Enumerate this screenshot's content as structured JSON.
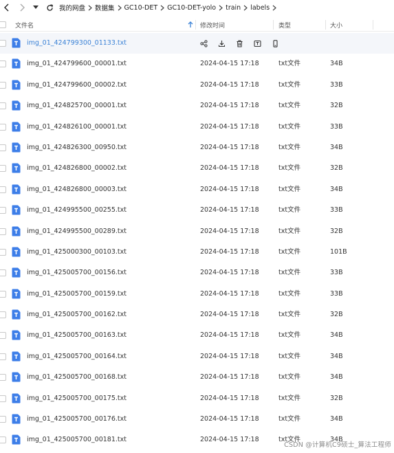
{
  "nav": {
    "breadcrumbs": [
      "我的网盘",
      "数据集",
      "GC10-DET",
      "GC10-DET-yolo",
      "train",
      "labels"
    ]
  },
  "header": {
    "name_label": "文件名",
    "modified_label": "修改时间",
    "type_label": "类型",
    "size_label": "大小"
  },
  "colors": {
    "file_icon": "#3d7ee8",
    "link": "#3b82d6",
    "hover_row": "#f4f6fa"
  },
  "files": [
    {
      "name": "img_01_424799300_01133.txt",
      "date": "",
      "type": "",
      "size": ""
    },
    {
      "name": "img_01_424799600_00001.txt",
      "date": "2024-04-15 17:18",
      "type": "txt文件",
      "size": "34B"
    },
    {
      "name": "img_01_424799600_00002.txt",
      "date": "2024-04-15 17:18",
      "type": "txt文件",
      "size": "33B"
    },
    {
      "name": "img_01_424825700_00001.txt",
      "date": "2024-04-15 17:18",
      "type": "txt文件",
      "size": "32B"
    },
    {
      "name": "img_01_424826100_00001.txt",
      "date": "2024-04-15 17:18",
      "type": "txt文件",
      "size": "33B"
    },
    {
      "name": "img_01_424826300_00950.txt",
      "date": "2024-04-15 17:18",
      "type": "txt文件",
      "size": "34B"
    },
    {
      "name": "img_01_424826800_00002.txt",
      "date": "2024-04-15 17:18",
      "type": "txt文件",
      "size": "32B"
    },
    {
      "name": "img_01_424826800_00003.txt",
      "date": "2024-04-15 17:18",
      "type": "txt文件",
      "size": "34B"
    },
    {
      "name": "img_01_424995500_00255.txt",
      "date": "2024-04-15 17:18",
      "type": "txt文件",
      "size": "33B"
    },
    {
      "name": "img_01_424995500_00289.txt",
      "date": "2024-04-15 17:18",
      "type": "txt文件",
      "size": "32B"
    },
    {
      "name": "img_01_425000300_00103.txt",
      "date": "2024-04-15 17:18",
      "type": "txt文件",
      "size": "101B"
    },
    {
      "name": "img_01_425005700_00156.txt",
      "date": "2024-04-15 17:18",
      "type": "txt文件",
      "size": "33B"
    },
    {
      "name": "img_01_425005700_00159.txt",
      "date": "2024-04-15 17:18",
      "type": "txt文件",
      "size": "33B"
    },
    {
      "name": "img_01_425005700_00162.txt",
      "date": "2024-04-15 17:18",
      "type": "txt文件",
      "size": "32B"
    },
    {
      "name": "img_01_425005700_00163.txt",
      "date": "2024-04-15 17:18",
      "type": "txt文件",
      "size": "34B"
    },
    {
      "name": "img_01_425005700_00164.txt",
      "date": "2024-04-15 17:18",
      "type": "txt文件",
      "size": "34B"
    },
    {
      "name": "img_01_425005700_00168.txt",
      "date": "2024-04-15 17:18",
      "type": "txt文件",
      "size": "34B"
    },
    {
      "name": "img_01_425005700_00175.txt",
      "date": "2024-04-15 17:18",
      "type": "txt文件",
      "size": "32B"
    },
    {
      "name": "img_01_425005700_00176.txt",
      "date": "2024-04-15 17:18",
      "type": "txt文件",
      "size": "34B"
    },
    {
      "name": "img_01_425005700_00181.txt",
      "date": "2024-04-15 17:18",
      "type": "txt文件",
      "size": "34B"
    }
  ],
  "hover_actions": [
    "share-icon",
    "download-icon",
    "delete-icon",
    "rename-icon",
    "more-icon"
  ],
  "watermark": "CSDN @计算机C9硕士_算法工程师"
}
